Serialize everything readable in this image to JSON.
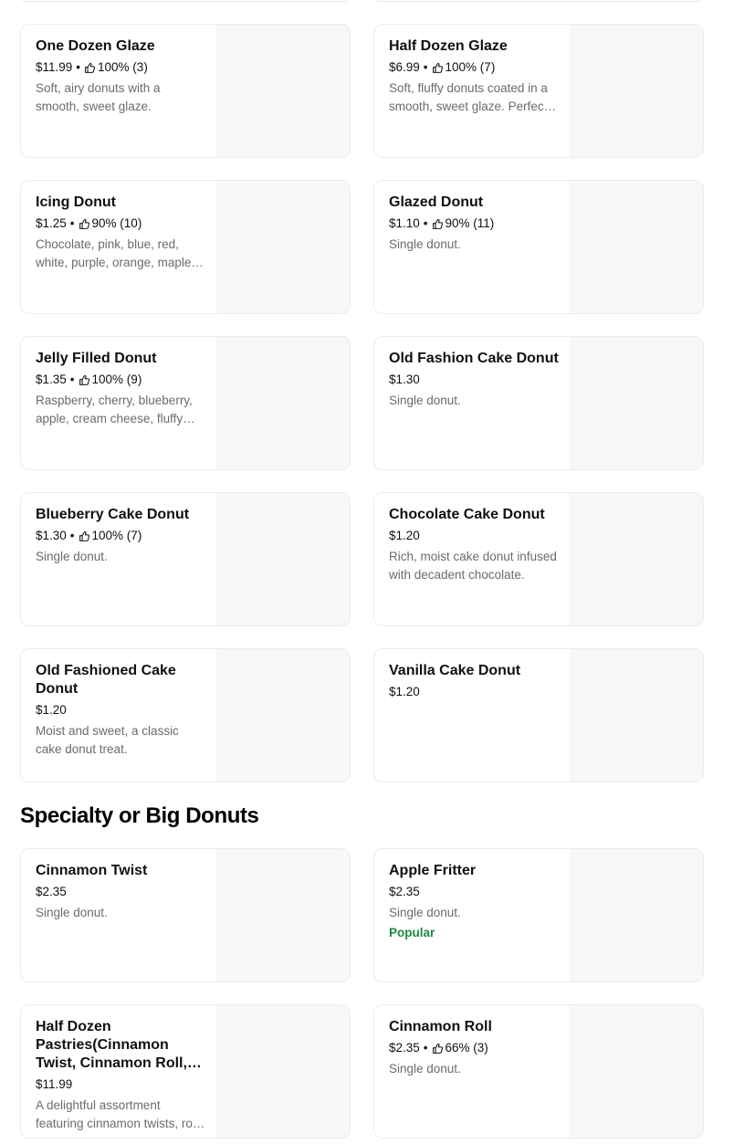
{
  "section_top": {
    "items": [
      {
        "name": "One Dozen Glaze",
        "price": "$11.99",
        "rating": "100% (3)",
        "desc": "Soft, airy donuts with a smooth, sweet glaze."
      },
      {
        "name": "Half Dozen Glaze",
        "price": "$6.99",
        "rating": "100% (7)",
        "desc": "Soft, fluffy donuts coated in a smooth, sweet glaze. Perfect for sharing."
      },
      {
        "name": "Icing Donut",
        "price": "$1.25",
        "rating": "90% (10)",
        "desc": "Chocolate, pink, blue, red, white, purple, orange, maple icing."
      },
      {
        "name": "Glazed Donut",
        "price": "$1.10",
        "rating": "90% (11)",
        "desc": "Single donut."
      },
      {
        "name": "Jelly Filled Donut",
        "price": "$1.35",
        "rating": "100% (9)",
        "desc": "Raspberry, cherry, blueberry, apple, cream cheese, fluffy filling."
      },
      {
        "name": "Old Fashion Cake Donut",
        "price": "$1.30",
        "rating": "",
        "desc": "Single donut."
      },
      {
        "name": "Blueberry Cake Donut",
        "price": "$1.30",
        "rating": "100% (7)",
        "desc": "Single donut."
      },
      {
        "name": "Chocolate Cake Donut",
        "price": "$1.20",
        "rating": "",
        "desc": "Rich, moist cake donut infused with decadent chocolate."
      },
      {
        "name": "Old Fashioned Cake Donut",
        "price": "$1.20",
        "rating": "",
        "desc": "Moist and sweet, a classic cake donut treat."
      },
      {
        "name": "Vanilla Cake Donut",
        "price": "$1.20",
        "rating": "",
        "desc": ""
      }
    ]
  },
  "specialty": {
    "title": "Specialty or Big Donuts",
    "items": [
      {
        "name": "Cinnamon Twist",
        "price": "$2.35",
        "rating": "",
        "desc": "Single donut.",
        "badge": ""
      },
      {
        "name": "Apple Fritter",
        "price": "$2.35",
        "rating": "",
        "desc": "Single donut.",
        "badge": "Popular"
      },
      {
        "name": "Half Dozen Pastries(Cinnamon Twist, Cinnamon Roll, Apple Fritter)",
        "price": "$11.99",
        "rating": "",
        "desc": "A delightful assortment featuring cinnamon twists, rolls and fritters.",
        "badge": ""
      },
      {
        "name": "Cinnamon Roll",
        "price": "$2.35",
        "rating": "66% (3)",
        "desc": "Single donut.",
        "badge": ""
      }
    ]
  },
  "icons": {
    "rating": "thumbs-up-icon"
  },
  "colors": {
    "badge": "#1a8a3f",
    "description": "#6b6b6b",
    "thumbnail": "#f7f7f7"
  }
}
